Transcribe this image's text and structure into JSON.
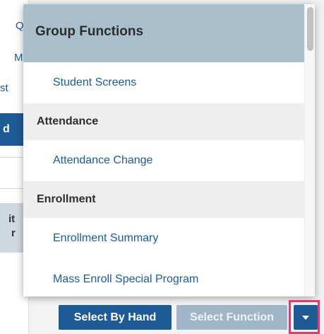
{
  "background": {
    "fragments": [
      "Q",
      "M",
      "st",
      "d",
      "it",
      "r"
    ]
  },
  "dropdown": {
    "header": "Group Functions",
    "items": [
      {
        "type": "item",
        "label": "Student Screens"
      },
      {
        "type": "group",
        "label": "Attendance"
      },
      {
        "type": "item",
        "label": "Attendance Change"
      },
      {
        "type": "group",
        "label": "Enrollment"
      },
      {
        "type": "item",
        "label": "Enrollment Summary"
      },
      {
        "type": "item",
        "label": "Mass Enroll Special Program"
      }
    ]
  },
  "buttons": {
    "select_by_hand": "Select By Hand",
    "select_function": "Select Function",
    "toggle_icon": "caret-down-icon"
  },
  "colors": {
    "primary": "#1e5a96",
    "disabled": "#9fb5c8",
    "header_bg": "#a9bfcc",
    "highlight": "#e23b72"
  }
}
